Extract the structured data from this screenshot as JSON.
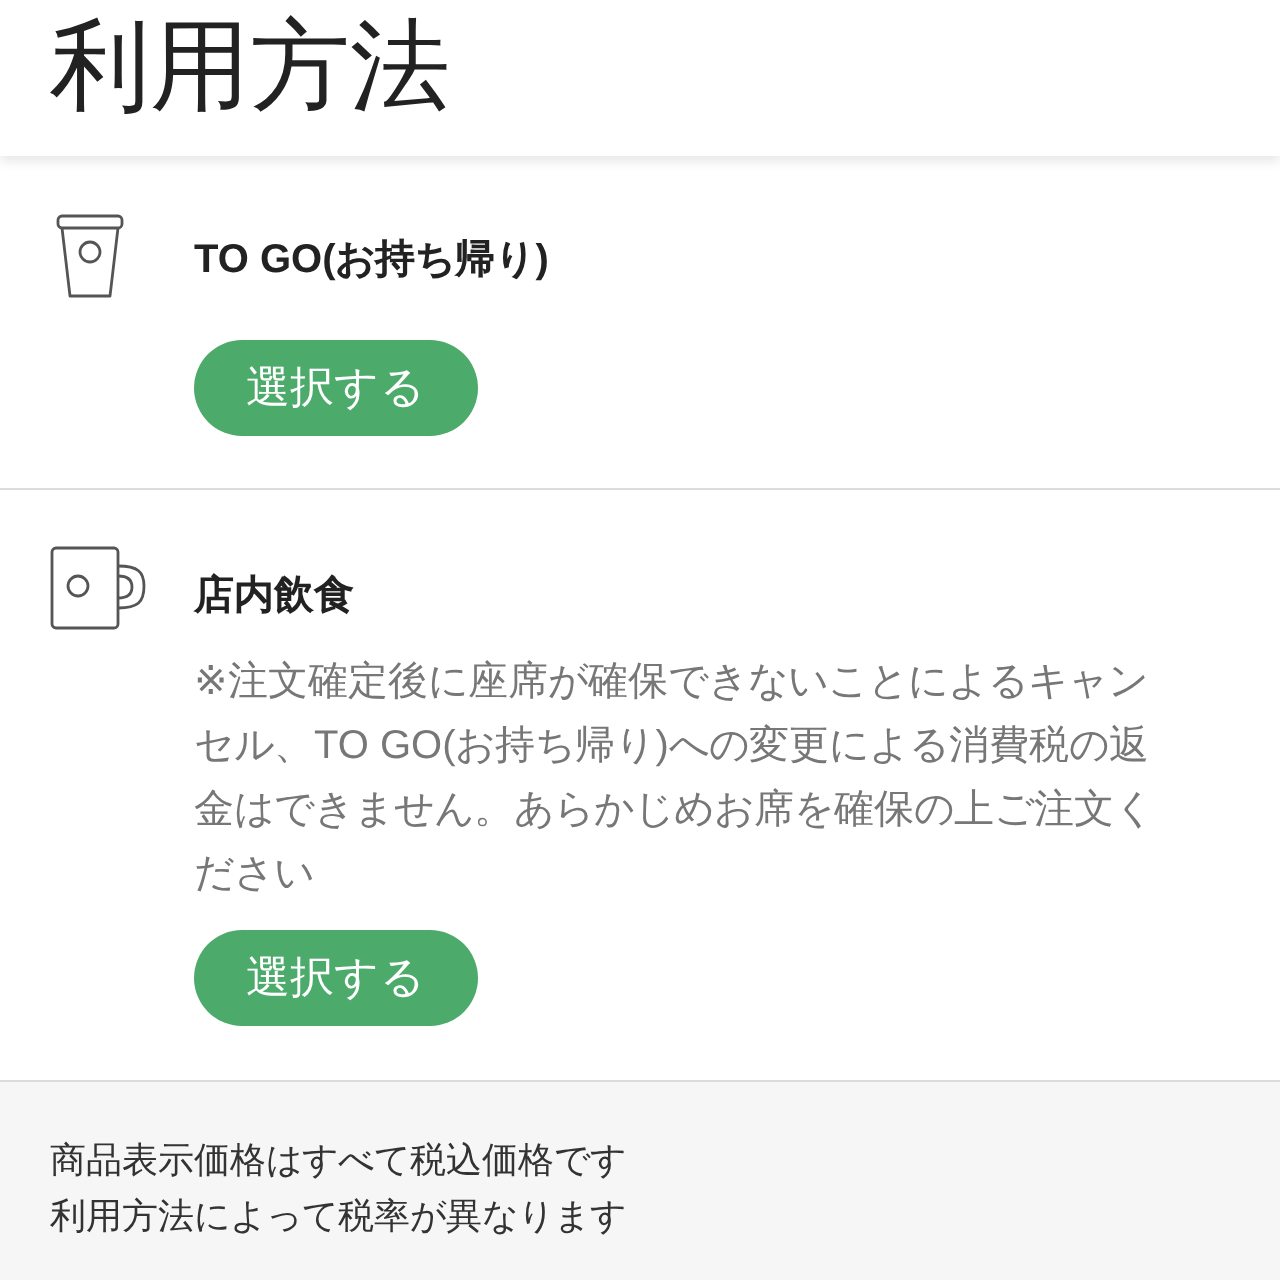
{
  "header": {
    "title": "利用方法"
  },
  "options": [
    {
      "kind": "togo",
      "label": "TO GO(お持ち帰り)",
      "button": "選択する"
    },
    {
      "kind": "eat_in",
      "label": "店内飲食",
      "note": "※注文確定後に座席が確保できないことによるキャンセル、TO GO(お持ち帰り)への変更による消費税の返金はできません。あらかじめお席を確保の上ご注文ください",
      "button": "選択する"
    }
  ],
  "footer": {
    "lines": [
      "商品表示価格はすべて税込価格です",
      "利用方法によって税率が異なります"
    ]
  }
}
